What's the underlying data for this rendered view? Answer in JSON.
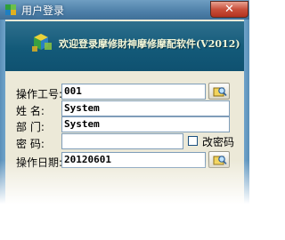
{
  "window": {
    "title": "用户登录",
    "close_symbol": "✕"
  },
  "banner": {
    "text": "欢迎登录摩修財神摩修摩配软件(V2012)"
  },
  "form": {
    "operator_id": {
      "label": "操作工号:",
      "value": "001"
    },
    "name": {
      "label": "姓    名:",
      "value": "System"
    },
    "department": {
      "label": "部    门:",
      "value": "System"
    },
    "password": {
      "label": "密    码:",
      "value": ""
    },
    "change_password": {
      "label": "改密码",
      "checked": false
    },
    "operation_date": {
      "label": "操作日期:",
      "value": "20120601"
    }
  },
  "colors": {
    "titlebar": "#4d7fa8",
    "banner": "#135a79",
    "client": "#ece9d8",
    "close": "#c9503b"
  },
  "icons": {
    "app": "app-cube-icon",
    "lookup": "lookup-icon",
    "close": "close-icon"
  }
}
